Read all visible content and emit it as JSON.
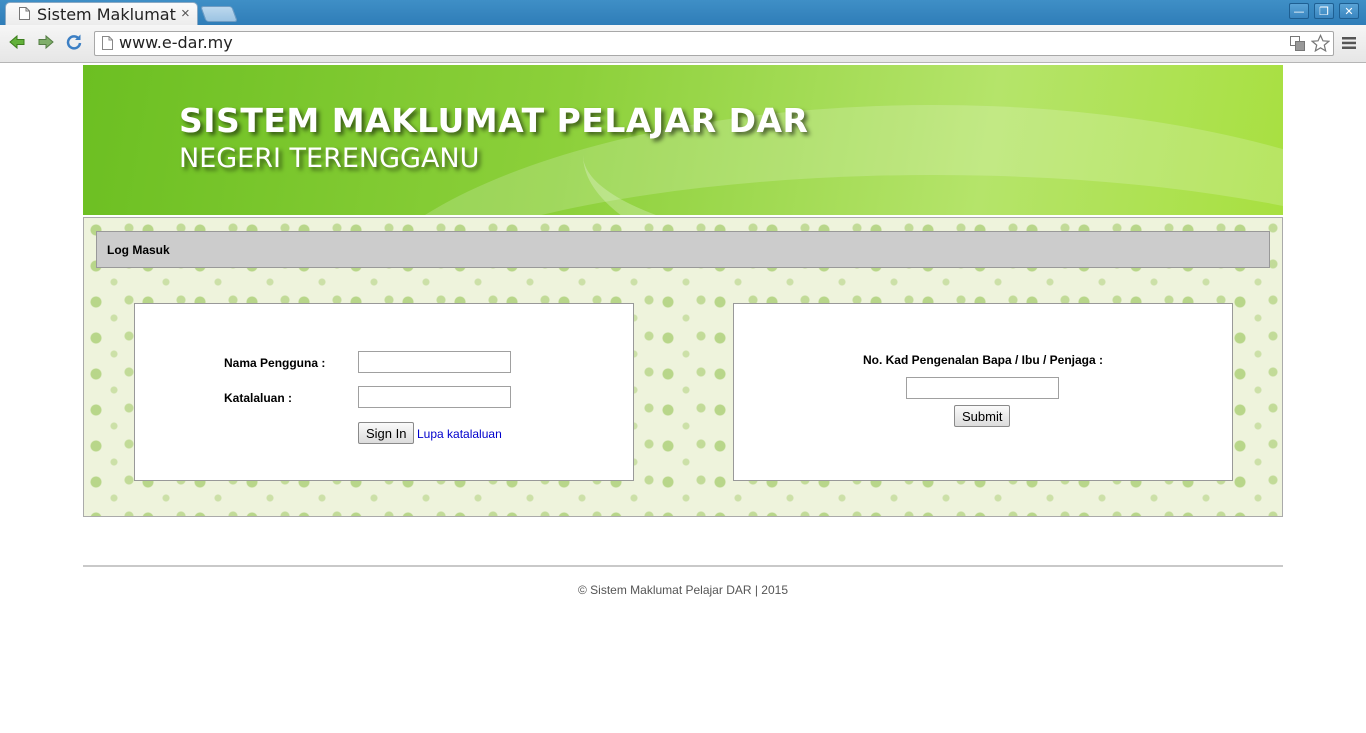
{
  "browser": {
    "tab_title": "Sistem Maklumat",
    "tab_close": "×",
    "url": "www.e-dar.my",
    "window_buttons": {
      "minimize": "—",
      "restore": "❐",
      "close": "✕"
    }
  },
  "banner": {
    "title": "SISTEM MAKLUMAT PELAJAR DAR",
    "subtitle": "NEGERI TERENGGANU"
  },
  "login_section": {
    "header": "Log Masuk",
    "staff_panel": {
      "username_label": "Nama Pengguna :",
      "username_value": "",
      "password_label": "Katalaluan :",
      "password_value": "",
      "sign_in_label": "Sign In",
      "forgot_password_link": "Lupa katalaluan"
    },
    "parent_panel": {
      "ic_label": "No. Kad Pengenalan Bapa / Ibu / Penjaga :",
      "ic_value": "",
      "submit_label": "Submit"
    }
  },
  "footer": {
    "copyright": "© Sistem Maklumat Pelajar DAR | 2015"
  },
  "colors": {
    "titlebar": "#3f8fc6",
    "banner_green": "#8cd03a",
    "section_bar": "#cccccc",
    "link": "#0000cc"
  }
}
